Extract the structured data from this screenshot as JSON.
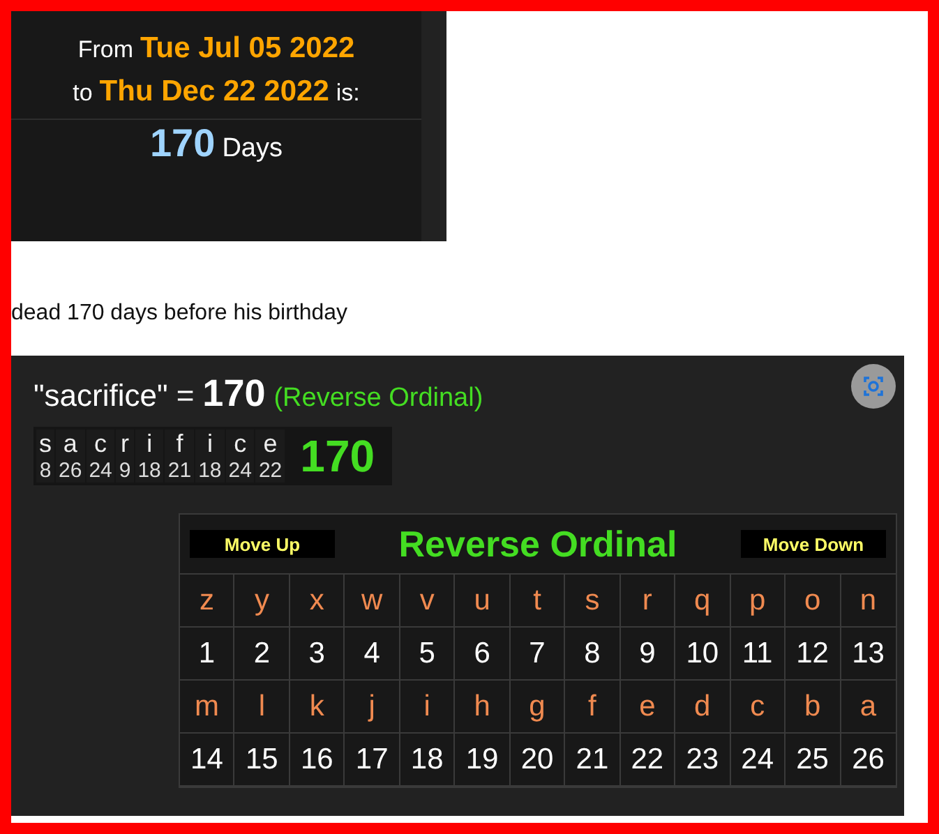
{
  "date_card": {
    "from_label": "From",
    "from_date": "Tue Jul 05 2022",
    "to_label": "to",
    "to_date": "Thu Dec 22 2022",
    "is_label": "is:",
    "count": "170",
    "unit": "Days"
  },
  "note": "dead 170 days before his birthday",
  "gematria": {
    "word": "\"sacrifice\"",
    "equals": "=",
    "total": "170",
    "cipher": "(Reverse Ordinal)",
    "letters": [
      {
        "letter": "s",
        "value": "8"
      },
      {
        "letter": "a",
        "value": "26"
      },
      {
        "letter": "c",
        "value": "24"
      },
      {
        "letter": "r",
        "value": "9"
      },
      {
        "letter": "i",
        "value": "18"
      },
      {
        "letter": "f",
        "value": "21"
      },
      {
        "letter": "i",
        "value": "18"
      },
      {
        "letter": "c",
        "value": "24"
      },
      {
        "letter": "e",
        "value": "22"
      }
    ],
    "sum": "170",
    "cipher_table": {
      "move_up": "Move Up",
      "title": "Reverse Ordinal",
      "move_down": "Move Down",
      "rows": [
        {
          "letters": [
            "z",
            "y",
            "x",
            "w",
            "v",
            "u",
            "t",
            "s",
            "r",
            "q",
            "p",
            "o",
            "n"
          ],
          "numbers": [
            "1",
            "2",
            "3",
            "4",
            "5",
            "6",
            "7",
            "8",
            "9",
            "10",
            "11",
            "12",
            "13"
          ]
        },
        {
          "letters": [
            "m",
            "l",
            "k",
            "j",
            "i",
            "h",
            "g",
            "f",
            "e",
            "d",
            "c",
            "b",
            "a"
          ],
          "numbers": [
            "14",
            "15",
            "16",
            "17",
            "18",
            "19",
            "20",
            "21",
            "22",
            "23",
            "24",
            "25",
            "26"
          ]
        }
      ]
    }
  }
}
